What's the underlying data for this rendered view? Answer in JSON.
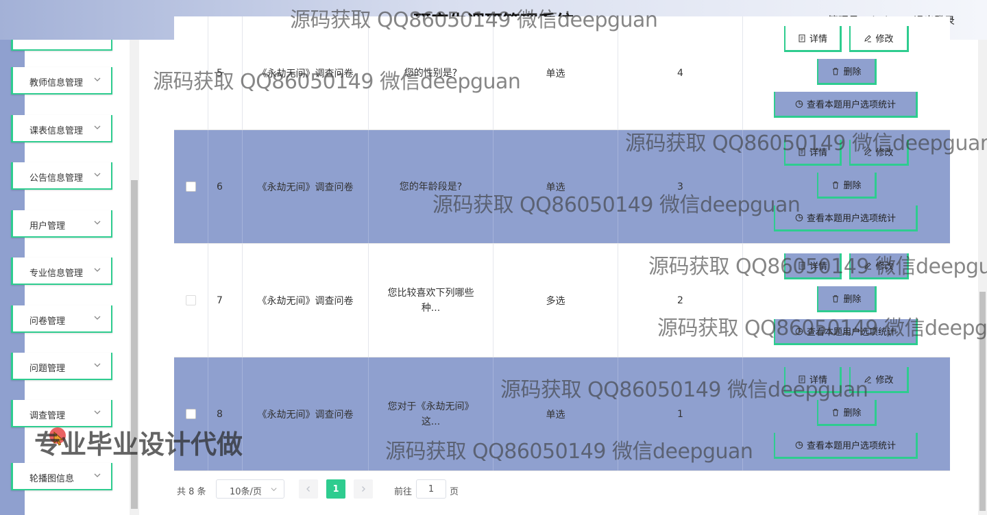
{
  "header": {
    "title": "研究生调研管理系统",
    "user": "管理员 admin",
    "logout": "退出登录",
    "gradient": [
      "#a3b1d7",
      "#f4f6fb"
    ]
  },
  "colors": {
    "accent": "#2ecc8f",
    "row_highlight": "#8fa0cf"
  },
  "sidebar": {
    "items": [
      {
        "label": ""
      },
      {
        "label": "教师信息管理"
      },
      {
        "label": "课表信息管理"
      },
      {
        "label": "公告信息管理"
      },
      {
        "label": "用户管理"
      },
      {
        "label": "专业信息管理"
      },
      {
        "label": "问卷管理"
      },
      {
        "label": "问题管理"
      },
      {
        "label": "调查管理"
      },
      {
        "label": "轮播图信息"
      }
    ],
    "chevron_icon": "chevron-down-icon"
  },
  "table": {
    "rows": [
      {
        "index": "5",
        "survey": "《永劫无间》调查问卷",
        "question": "您的性别是?",
        "type": "单选",
        "order": "4"
      },
      {
        "index": "6",
        "survey": "《永劫无间》调查问卷",
        "question": "您的年龄段是?",
        "type": "单选",
        "order": "3"
      },
      {
        "index": "7",
        "survey": "《永劫无间》调查问卷",
        "question": "您比较喜欢下列哪些种...",
        "type": "多选",
        "order": "2"
      },
      {
        "index": "8",
        "survey": "《永劫无间》调查问卷",
        "question": "您对于《永劫无间》这...",
        "type": "单选",
        "order": "1"
      }
    ],
    "actions": {
      "detail": "详情",
      "edit": "修改",
      "delete": "删除",
      "stats": "查看本题用户选项统计"
    }
  },
  "pagination": {
    "total": "共 8 条",
    "page_size": "10条/页",
    "current_page": "1",
    "goto_label": "前往",
    "goto_value": "1",
    "page_suffix": "页"
  },
  "watermarks": {
    "text": "源码获取 QQ86050149 微信deepguan",
    "text_cut": "源码获取 QQ86050149 微信deepgu",
    "text_cut2": "源码获取 QQ86050149 微信deepg",
    "text_cut3": "源码获取 QQ86050149 微信deepguar",
    "banner": "专业毕业设计代做"
  }
}
